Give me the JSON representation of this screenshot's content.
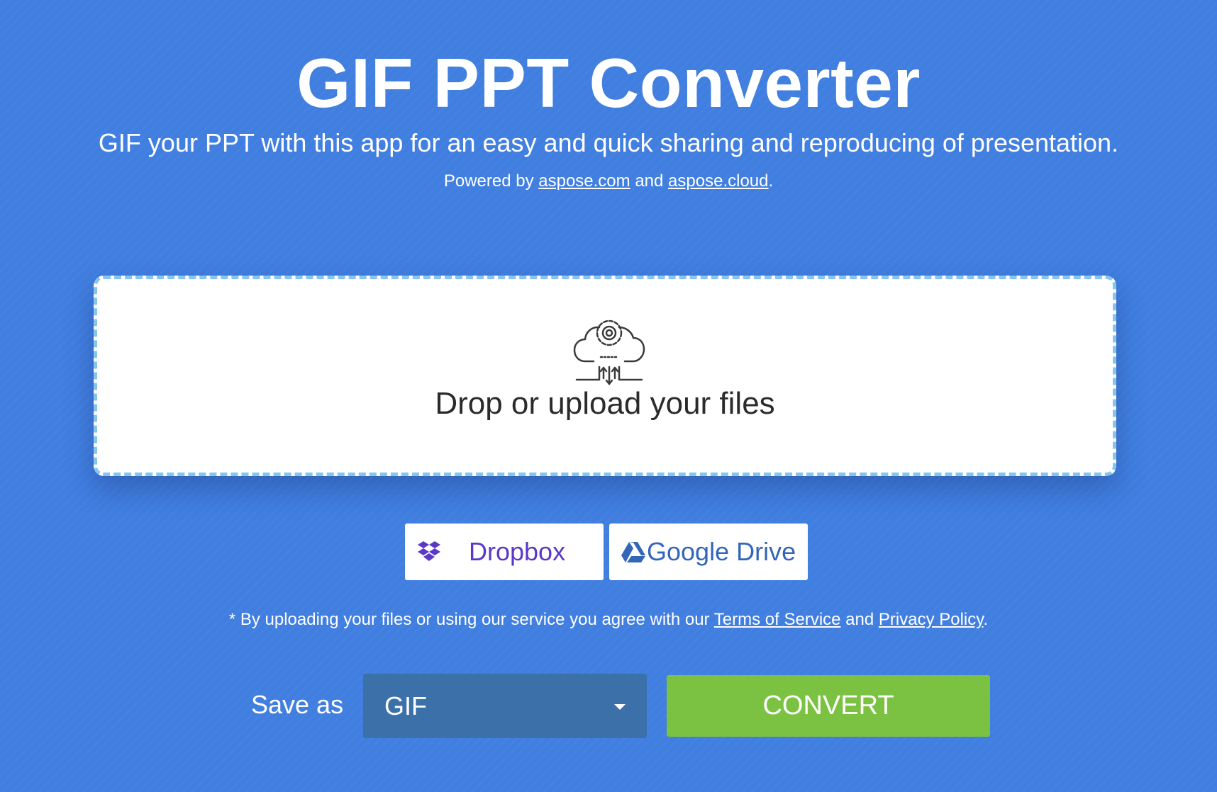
{
  "header": {
    "title": "GIF PPT Converter",
    "subtitle": "GIF your PPT with this app for an easy and quick sharing and reproducing of presentation.",
    "powered_prefix": "Powered by ",
    "powered_link1": "aspose.com",
    "powered_and": " and ",
    "powered_link2": "aspose.cloud",
    "powered_suffix": "."
  },
  "upload": {
    "drop_text": "Drop or upload your files",
    "icon": "cloud-upload-gear-icon"
  },
  "cloud_buttons": {
    "dropbox_label": "Dropbox",
    "dropbox_icon": "dropbox-icon",
    "dropbox_color": "#5c38c9",
    "gdrive_label": "Google Drive",
    "gdrive_icon": "google-drive-icon",
    "gdrive_color": "#3466b8"
  },
  "terms": {
    "prefix": "* By uploading your files or using our service you agree with our ",
    "tos_link": "Terms of Service",
    "and": " and ",
    "privacy_link": "Privacy Policy",
    "suffix": "."
  },
  "convert_form": {
    "save_label": "Save as",
    "format_value": "GIF",
    "convert_label": "CONVERT"
  },
  "colors": {
    "background": "#407ee0",
    "dropzone_border": "#86c6ee",
    "select_bg": "#3b71a8",
    "convert_bg": "#7cc242"
  }
}
